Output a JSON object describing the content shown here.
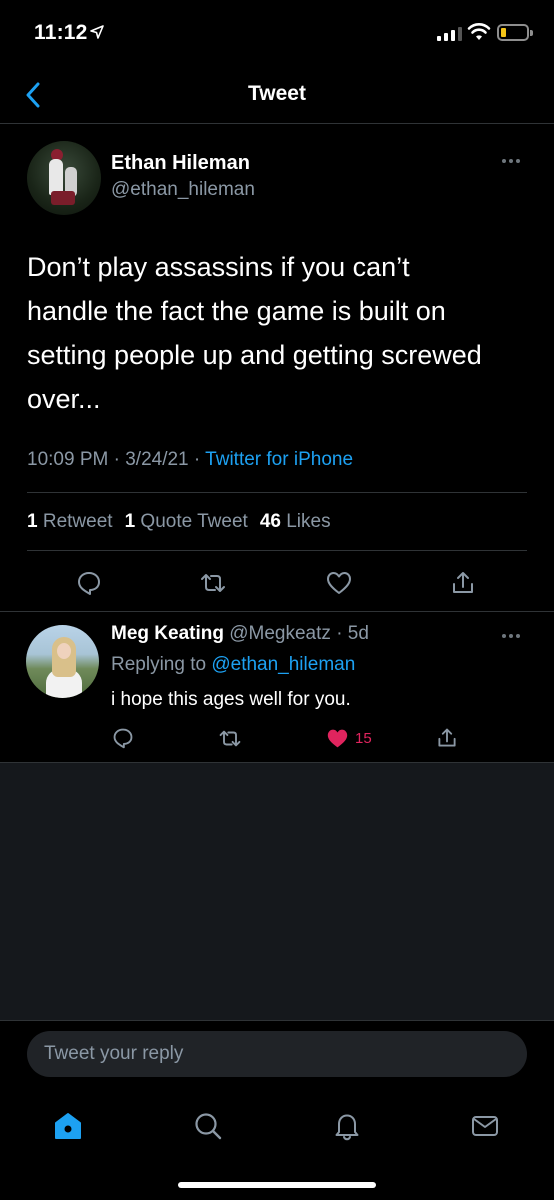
{
  "status_bar": {
    "time": "11:12"
  },
  "header": {
    "title": "Tweet"
  },
  "tweet": {
    "author_name": "Ethan Hileman",
    "author_handle": "@ethan_hileman",
    "text": "Don’t play assassins if you can’t\nhandle the fact the game is built on\nsetting people up and getting screwed\nover...",
    "time": "10:09 PM",
    "date": "3/24/21",
    "source": "Twitter for iPhone",
    "retweet_count": "1",
    "retweet_label": "Retweet",
    "quote_count": "1",
    "quote_label": "Quote Tweet",
    "like_count": "46",
    "like_label": "Likes"
  },
  "reply": {
    "author_name": "Meg Keating",
    "author_handle": "@Megkeatz",
    "age": "5d",
    "replying_to_label": "Replying to",
    "replying_to_handle": "@ethan_hileman",
    "text": "i hope this ages well for you.",
    "like_count": "15",
    "liked": true
  },
  "compose": {
    "placeholder": "Tweet your reply"
  },
  "colors": {
    "accent": "#1da1f2",
    "like": "#e0245e",
    "secondary_text": "#8b98a5",
    "divider": "#2f3336",
    "background": "#000000"
  },
  "tabs": [
    "home-icon",
    "search-icon",
    "notifications-icon",
    "messages-icon"
  ]
}
